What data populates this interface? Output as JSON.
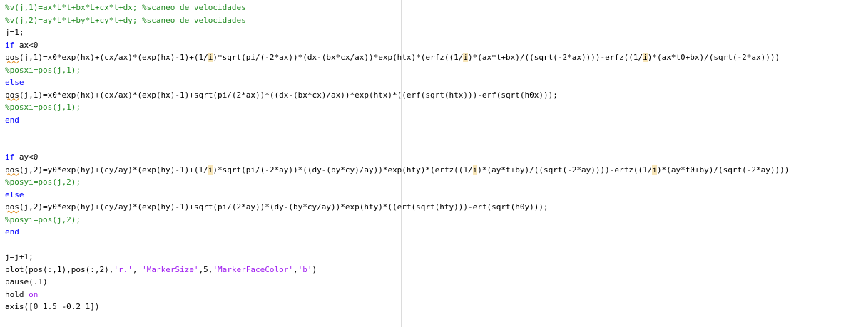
{
  "editor": {
    "lines": [
      {
        "type": "comment",
        "text": "%v(j,1)=ax*L*t+bx*L+cx*t+dx; %scaneo de velocidades"
      },
      {
        "type": "comment",
        "text": "%v(j,2)=ay*L*t+by*L+cy*t+dy; %scaneo de velocidades"
      },
      {
        "type": "code",
        "text": "j=1;"
      },
      {
        "type": "code",
        "parts": [
          {
            "t": "if",
            "c": "kw"
          },
          {
            "t": " ax<0"
          }
        ]
      },
      {
        "type": "code",
        "parts": [
          {
            "t": "pos",
            "c": "squiggle"
          },
          {
            "t": "(j,1)=x0*exp(hx)+(cx/ax)*(exp(hx)-1)+(1/"
          },
          {
            "t": "i",
            "c": "var-hl"
          },
          {
            "t": ")*sqrt(pi/(-2*ax))*(dx-(bx*cx/ax))*exp(htx)*(erfz((1/"
          },
          {
            "t": "i",
            "c": "var-hl"
          },
          {
            "t": ")*(ax*t+bx)/((sqrt(-2*ax))))-erfz((1/"
          },
          {
            "t": "i",
            "c": "var-hl"
          },
          {
            "t": ")*(ax*t0+bx)/(sqrt(-2*ax))))"
          }
        ]
      },
      {
        "type": "comment",
        "text": "%posxi=pos(j,1);"
      },
      {
        "type": "code",
        "parts": [
          {
            "t": "else",
            "c": "kw"
          }
        ]
      },
      {
        "type": "code",
        "parts": [
          {
            "t": "pos",
            "c": "squiggle"
          },
          {
            "t": "(j,1)=x0*exp(hx)+(cx/ax)*(exp(hx)-1)+sqrt(pi/(2*ax))*((dx-(bx*cx)/ax))*exp(htx)*((erf(sqrt(htx)))-erf(sqrt(h0x)));"
          }
        ]
      },
      {
        "type": "comment",
        "text": "%posxi=pos(j,1);"
      },
      {
        "type": "code",
        "parts": [
          {
            "t": "end",
            "c": "kw"
          }
        ]
      },
      {
        "type": "blank",
        "text": ""
      },
      {
        "type": "blank",
        "text": ""
      },
      {
        "type": "code",
        "parts": [
          {
            "t": "if",
            "c": "kw"
          },
          {
            "t": " ay<0"
          }
        ]
      },
      {
        "type": "code",
        "parts": [
          {
            "t": "pos",
            "c": "squiggle"
          },
          {
            "t": "(j,2)=y0*exp(hy)+(cy/ay)*(exp(hy)-1)+(1/"
          },
          {
            "t": "i",
            "c": "var-hl"
          },
          {
            "t": ")*sqrt(pi/(-2*ay))*((dy-(by*cy)/ay))*exp(hty)*(erfz((1/"
          },
          {
            "t": "i",
            "c": "var-hl"
          },
          {
            "t": ")*(ay*t+by)/((sqrt(-2*ay))))-erfz((1/"
          },
          {
            "t": "i",
            "c": "var-hl"
          },
          {
            "t": ")*(ay*t0+by)/(sqrt(-2*ay))))"
          }
        ]
      },
      {
        "type": "comment",
        "text": "%posyi=pos(j,2);"
      },
      {
        "type": "code",
        "parts": [
          {
            "t": "else",
            "c": "kw"
          }
        ]
      },
      {
        "type": "code",
        "parts": [
          {
            "t": "pos",
            "c": "squiggle"
          },
          {
            "t": "(j,2)=y0*exp(hy)+(cy/ay)*(exp(hy)-1)+sqrt(pi/(2*ay))*(dy-(by*cy/ay))*exp(hty)*((erf(sqrt(hty)))-erf(sqrt(h0y)));"
          }
        ]
      },
      {
        "type": "comment",
        "text": "%posyi=pos(j,2);"
      },
      {
        "type": "code",
        "parts": [
          {
            "t": "end",
            "c": "kw"
          }
        ]
      },
      {
        "type": "blank",
        "text": ""
      },
      {
        "type": "code",
        "text": "j=j+1;"
      },
      {
        "type": "code",
        "parts": [
          {
            "t": "plot(pos(:,1),pos(:,2),"
          },
          {
            "t": "'r.'",
            "c": "str"
          },
          {
            "t": ", "
          },
          {
            "t": "'MarkerSize'",
            "c": "str"
          },
          {
            "t": ",5,"
          },
          {
            "t": "'MarkerFaceColor'",
            "c": "str"
          },
          {
            "t": ","
          },
          {
            "t": "'b'",
            "c": "str"
          },
          {
            "t": ")"
          }
        ]
      },
      {
        "type": "code",
        "text": "pause(.1)"
      },
      {
        "type": "code",
        "parts": [
          {
            "t": "hold "
          },
          {
            "t": "on",
            "c": "str"
          }
        ]
      },
      {
        "type": "code",
        "text": "axis([0 1.5 -0.2 1])"
      },
      {
        "type": "blank",
        "text": ""
      },
      {
        "type": "code",
        "parts": [
          {
            "t": "end",
            "c": "kw"
          }
        ]
      }
    ]
  },
  "colors": {
    "comment": "#228b22",
    "keyword": "#0000ff",
    "string": "#a020f0",
    "highlight": "#f8e6b8"
  }
}
